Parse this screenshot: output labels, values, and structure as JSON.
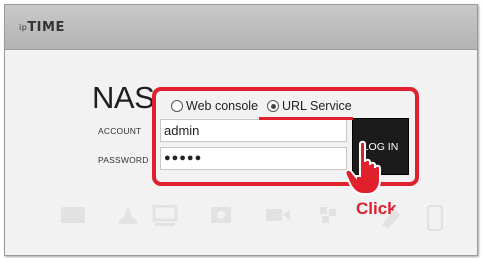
{
  "header": {
    "brand_prefix": "ip",
    "brand_name": "TIME"
  },
  "login": {
    "title": "NAS",
    "mode_options": [
      {
        "label": "Web console",
        "selected": false
      },
      {
        "label": "URL Service",
        "selected": true
      }
    ],
    "account_label": "ACCOUNT",
    "account_value": "admin",
    "password_label": "PASSWORD",
    "password_value": "●●●●●",
    "login_button": "LOG IN"
  },
  "annotation": {
    "click_label": "Click",
    "highlight_color": "#e0202c"
  },
  "footer_icons": [
    "storage-icon",
    "photo-icon",
    "monitor-icon",
    "camera-icon",
    "video-icon",
    "music-icon",
    "document-icon",
    "phone-icon"
  ]
}
